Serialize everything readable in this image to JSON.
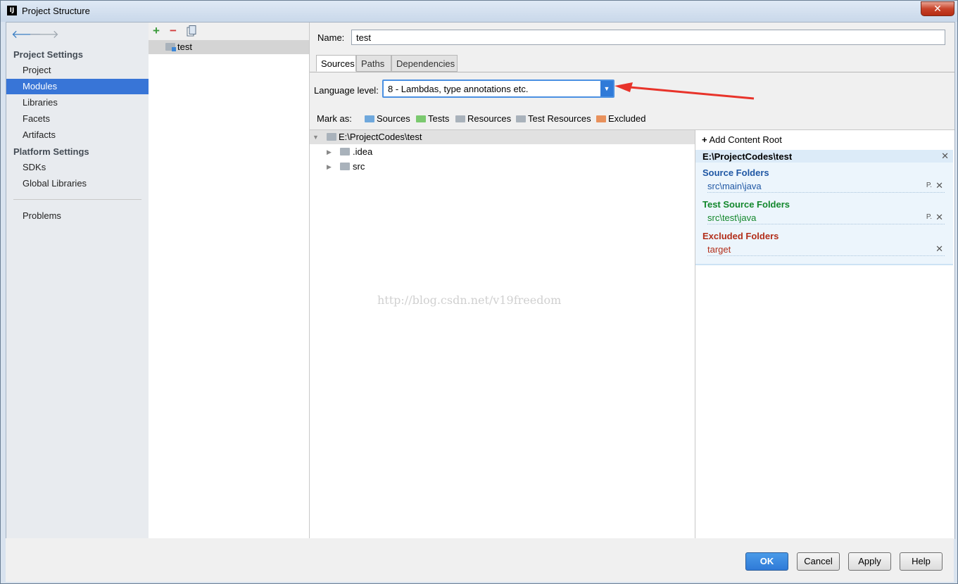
{
  "window": {
    "title": "Project Structure",
    "icon_label": "IJ"
  },
  "sidebar": {
    "back_icon": "arrow-left-icon",
    "forward_icon": "arrow-right-icon",
    "sections": [
      {
        "header": "Project Settings",
        "items": [
          "Project",
          "Modules",
          "Libraries",
          "Facets",
          "Artifacts"
        ]
      },
      {
        "header": "Platform Settings",
        "items": [
          "SDKs",
          "Global Libraries"
        ]
      }
    ],
    "problems": "Problems",
    "selected": "Modules"
  },
  "modules": {
    "toolbar": {
      "add": "+",
      "remove": "−",
      "copy": "copy-icon"
    },
    "items": [
      "test"
    ]
  },
  "module": {
    "name_label": "Name:",
    "name_value": "test",
    "tabs": [
      "Sources",
      "Paths",
      "Dependencies"
    ],
    "active_tab": "Sources",
    "language_level_label": "Language level:",
    "language_level_value": "8 - Lambdas, type annotations etc.",
    "mark_as_label": "Mark as:",
    "mark_as": [
      {
        "label": "Sources",
        "color": "#6fa8dc"
      },
      {
        "label": "Tests",
        "color": "#7bc96f"
      },
      {
        "label": "Resources",
        "color": "#a9b2bb"
      },
      {
        "label": "Test Resources",
        "color": "#a9b2bb"
      },
      {
        "label": "Excluded",
        "color": "#e8915c"
      }
    ]
  },
  "tree": {
    "root": "E:\\ProjectCodes\\test",
    "children": [
      ".idea",
      "src"
    ]
  },
  "watermark": "http://blog.csdn.net/v19freedom",
  "content_root": {
    "add_label": "Add Content Root",
    "path": "E:\\ProjectCodes\\test",
    "source_folders_title": "Source Folders",
    "source_folders": [
      "src\\main\\java"
    ],
    "test_folders_title": "Test Source Folders",
    "test_folders": [
      "src\\test\\java"
    ],
    "excluded_title": "Excluded Folders",
    "excluded_folders": [
      "target"
    ],
    "colors": {
      "source": "#1f57a4",
      "test": "#12872b",
      "excluded": "#b22e1a"
    }
  },
  "buttons": {
    "ok": "OK",
    "cancel": "Cancel",
    "apply": "Apply",
    "help": "Help"
  }
}
